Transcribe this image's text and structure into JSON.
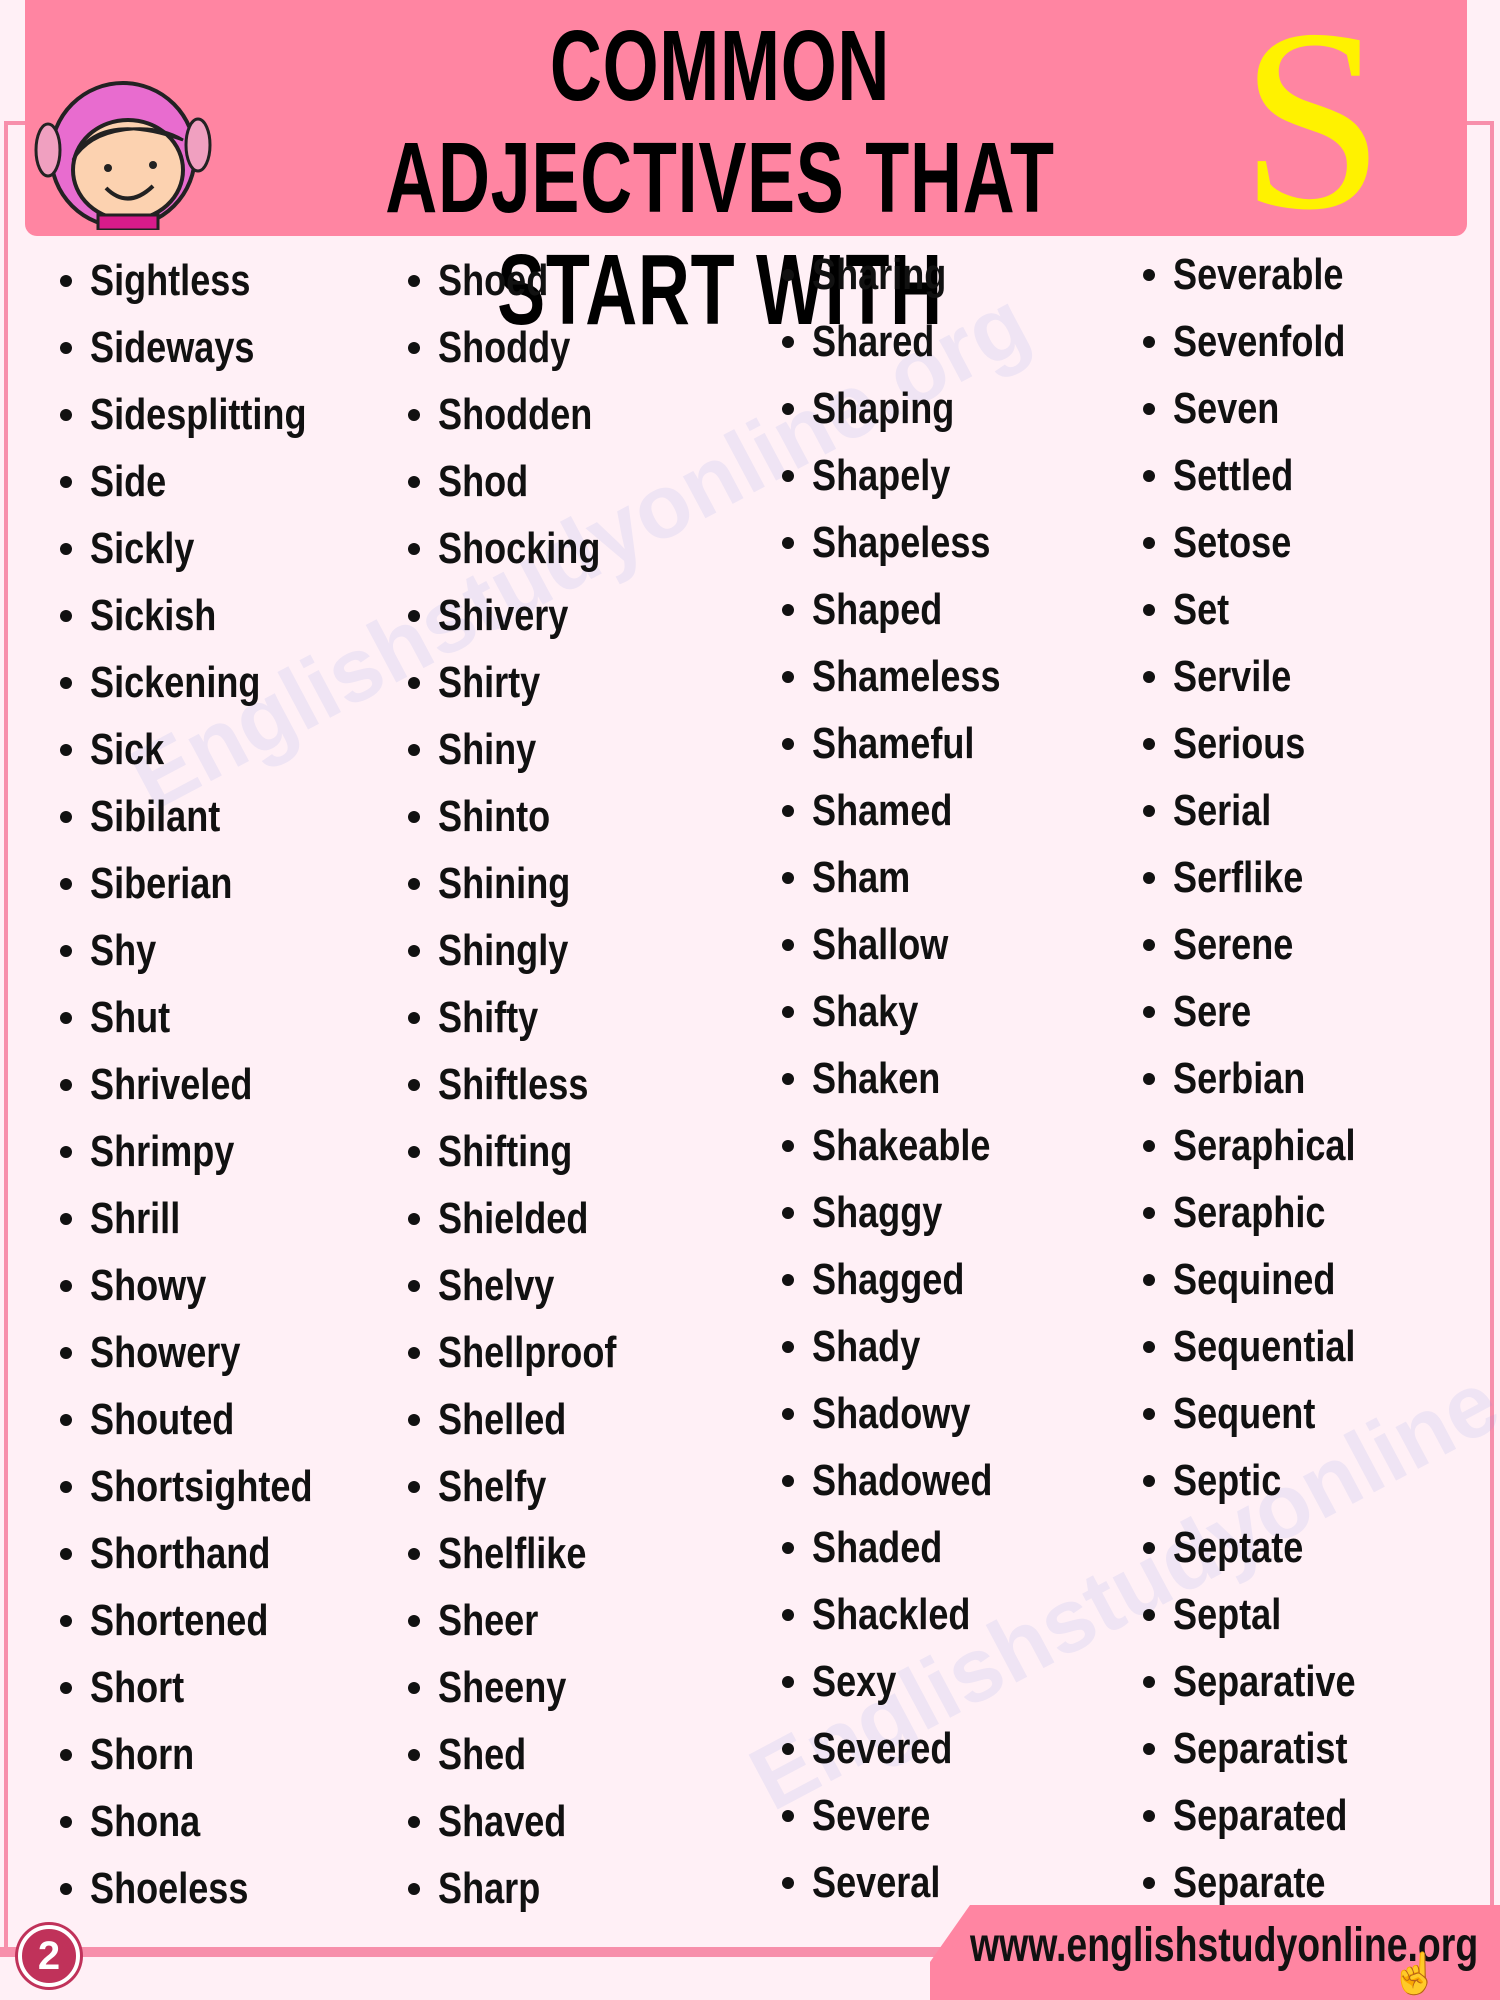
{
  "header": {
    "title_line1": "COMMON ADJECTIVES THAT",
    "title_line2": "START WITH",
    "letter": "S"
  },
  "colors": {
    "header_bg": "#ff85a2",
    "page_bg": "#fff0f6",
    "letter": "#fff200",
    "badge": "#c0325a"
  },
  "columns": [
    [
      "Sightless",
      "Sideways",
      "Sidesplitting",
      "Side",
      "Sickly",
      "Sickish",
      "Sickening",
      "Sick",
      "Sibilant",
      "Siberian",
      "Shy",
      "Shut",
      "Shriveled",
      "Shrimpy",
      "Shrill",
      "Showy",
      "Showery",
      "Shouted",
      "Shortsighted",
      "Shorthand",
      "Shortened",
      "Short",
      "Shorn",
      "Shona",
      "Shoeless"
    ],
    [
      "Shoed",
      "Shoddy",
      "Shodden",
      "Shod",
      "Shocking",
      "Shivery",
      "Shirty",
      "Shiny",
      "Shinto",
      "Shining",
      "Shingly",
      "Shifty",
      "Shiftless",
      "Shifting",
      "Shielded",
      "Shelvy",
      "Shellproof",
      "Shelled",
      "Shelfy",
      "Shelflike",
      "Sheer",
      "Sheeny",
      "Shed",
      "Shaved",
      "Sharp"
    ],
    [
      "Sharing",
      "Shared",
      "Shaping",
      "Shapely",
      "Shapeless",
      "Shaped",
      "Shameless",
      "Shameful",
      "Shamed",
      "Sham",
      "Shallow",
      "Shaky",
      "Shaken",
      "Shakeable",
      "Shaggy",
      "Shagged",
      "Shady",
      "Shadowy",
      "Shadowed",
      "Shaded",
      "Shackled",
      "Sexy",
      "Severed",
      "Severe",
      "Several"
    ],
    [
      "Severable",
      "Sevenfold",
      "Seven",
      "Settled",
      "Setose",
      "Set",
      "Servile",
      "Serious",
      "Serial",
      "Serflike",
      "Serene",
      "Sere",
      "Serbian",
      "Seraphical",
      "Seraphic",
      "Sequined",
      "Sequential",
      "Sequent",
      "Septic",
      "Septate",
      "Septal",
      "Separative",
      "Separatist",
      "Separated",
      "Separate"
    ]
  ],
  "footer": {
    "url": "www.englishstudyonline.org",
    "page_number": "2"
  },
  "watermark": "Englishstudyonline.org"
}
